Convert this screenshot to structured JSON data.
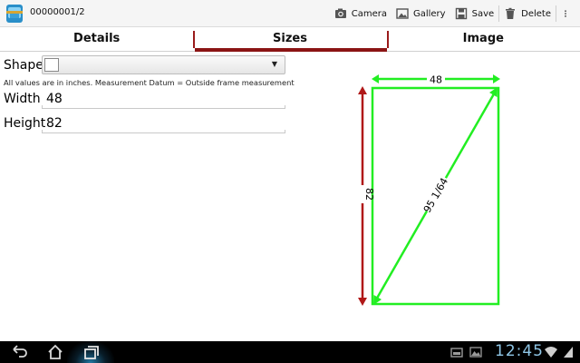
{
  "header": {
    "record_id": "00000001/2",
    "actions": [
      {
        "id": "camera",
        "label": "Camera",
        "icon": "camera-icon"
      },
      {
        "id": "gallery",
        "label": "Gallery",
        "icon": "gallery-icon"
      },
      {
        "id": "save",
        "label": "Save",
        "icon": "save-icon"
      },
      {
        "id": "delete",
        "label": "Delete",
        "icon": "trash-icon"
      }
    ],
    "overflow_icon": "overflow-menu-icon"
  },
  "tabs": [
    {
      "label": "Details",
      "active": false
    },
    {
      "label": "Sizes",
      "active": true
    },
    {
      "label": "Image",
      "active": false
    }
  ],
  "form": {
    "shape_label": "Shape",
    "shape_value": "",
    "note": "All values are in inches. Measurement Datum = Outside frame measurement",
    "width_label": "Width",
    "width_value": "48",
    "height_label": "Height",
    "height_value": "82"
  },
  "diagram": {
    "width_label": "48",
    "height_label": "82",
    "diagonal_label": "95 1/64",
    "frame_color": "#22ee22",
    "height_arrow_color": "#b01818"
  },
  "status_bar": {
    "time": "12:45",
    "nav_buttons": [
      "back-icon",
      "home-icon",
      "recent-apps-icon"
    ],
    "status_icons": [
      "storage-icon",
      "image-notification-icon",
      "wifi-icon",
      "signal-icon"
    ]
  },
  "colors": {
    "accent": "#8b1414",
    "clock": "#8fc6e6"
  }
}
